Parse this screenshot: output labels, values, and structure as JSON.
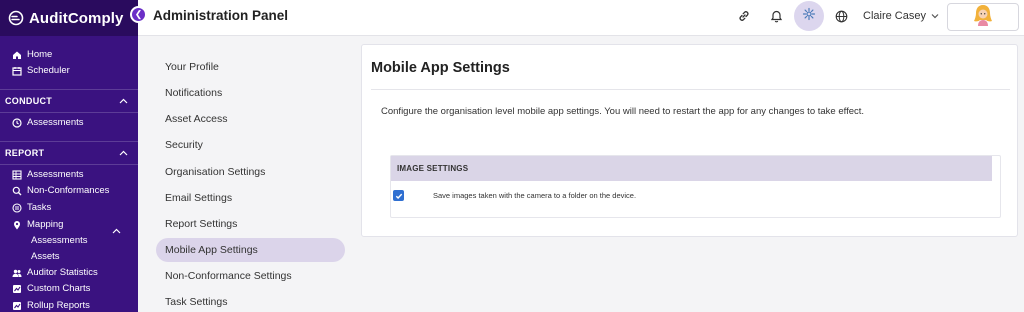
{
  "app": {
    "name": "AuditComply",
    "page_title": "Administration Panel"
  },
  "header": {
    "user_name": "Claire Casey",
    "icons": [
      "link-icon",
      "bell-icon",
      "gear-icon",
      "globe-icon",
      "chevron-down-icon"
    ]
  },
  "sidebar": {
    "top_items": [
      {
        "label": "Home",
        "icon": "home-icon"
      },
      {
        "label": "Scheduler",
        "icon": "calendar-icon"
      }
    ],
    "sections": [
      {
        "title": "CONDUCT",
        "items": [
          {
            "label": "Assessments",
            "icon": "clock-icon"
          }
        ]
      },
      {
        "title": "REPORT",
        "items": [
          {
            "label": "Assessments",
            "icon": "table-icon"
          },
          {
            "label": "Non-Conformances",
            "icon": "search-icon"
          },
          {
            "label": "Tasks",
            "icon": "tasks-icon"
          },
          {
            "label": "Mapping",
            "icon": "map-pin-icon",
            "children": [
              "Assessments",
              "Assets"
            ]
          },
          {
            "label": "Auditor Statistics",
            "icon": "users-icon"
          },
          {
            "label": "Custom Charts",
            "icon": "chart-icon"
          },
          {
            "label": "Rollup Reports",
            "icon": "chart-icon"
          }
        ]
      }
    ]
  },
  "settings_menu": {
    "items": [
      "Your Profile",
      "Notifications",
      "Asset Access",
      "Security",
      "Organisation Settings",
      "Email Settings",
      "Report Settings",
      "Mobile App Settings",
      "Non-Conformance Settings",
      "Task Settings"
    ],
    "active": "Mobile App Settings"
  },
  "main": {
    "title": "Mobile App Settings",
    "description": "Configure the organisation level mobile app settings. You will need to restart the app for any changes to take effect.",
    "image_settings": {
      "header": "IMAGE SETTINGS",
      "option_label": "Save images taken with the camera to a folder on the device.",
      "option_checked": true
    }
  },
  "colors": {
    "brand_bg": "#2a0b5e",
    "sidebar_bg": "#3a1280",
    "accent": "#6b2fc7",
    "active_menu_bg": "#dbd4ea",
    "section_header_bg": "#dad5e7",
    "checkbox": "#2f6fd1"
  }
}
